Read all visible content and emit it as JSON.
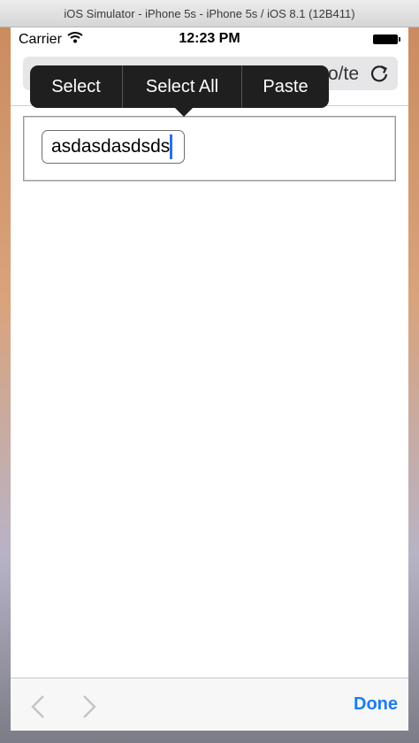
{
  "window": {
    "title": "iOS Simulator - iPhone 5s - iPhone 5s / iOS 8.1 (12B411)"
  },
  "status_bar": {
    "carrier": "Carrier",
    "time": "12:23 PM"
  },
  "address_bar": {
    "visible_url_fragment": "o/te"
  },
  "web_content": {
    "input_value": "asdasdasdsds"
  },
  "edit_menu": {
    "items": [
      "Select",
      "Select All",
      "Paste"
    ]
  },
  "toolbar": {
    "done_label": "Done"
  },
  "colors": {
    "accent": "#1a7cf0",
    "caret": "#2e6fe6",
    "menu_bg": "#1f1f1f"
  }
}
